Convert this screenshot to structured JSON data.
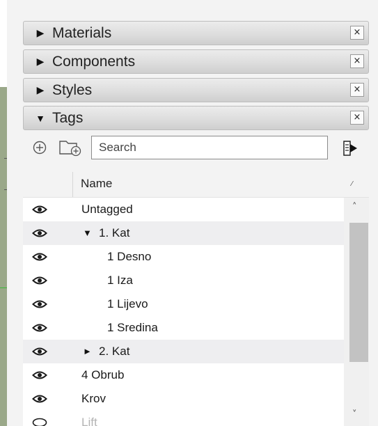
{
  "panels": [
    {
      "title": "Materials",
      "expanded": false,
      "close_label": "×"
    },
    {
      "title": "Components",
      "expanded": false,
      "close_label": "×"
    },
    {
      "title": "Styles",
      "expanded": false,
      "close_label": "×"
    },
    {
      "title": "Tags",
      "expanded": true,
      "close_label": "×"
    }
  ],
  "toolbar": {
    "search_placeholder": "Search",
    "icons": [
      "add-tag-icon",
      "add-folder-icon",
      "details-icon"
    ]
  },
  "table": {
    "column_name": "Name"
  },
  "tags": [
    {
      "label": "Untagged",
      "visible": true,
      "indent": 0,
      "expander": "",
      "alt": false,
      "faded": false
    },
    {
      "label": "1. Kat",
      "visible": true,
      "indent": 1,
      "expander": "▼",
      "alt": true,
      "faded": false
    },
    {
      "label": "1 Desno",
      "visible": true,
      "indent": 2,
      "expander": "",
      "alt": false,
      "faded": false
    },
    {
      "label": "1 Iza",
      "visible": true,
      "indent": 2,
      "expander": "",
      "alt": false,
      "faded": false
    },
    {
      "label": "1 Lijevo",
      "visible": true,
      "indent": 2,
      "expander": "",
      "alt": false,
      "faded": false
    },
    {
      "label": "1 Sredina",
      "visible": true,
      "indent": 2,
      "expander": "",
      "alt": false,
      "faded": false
    },
    {
      "label": "2. Kat",
      "visible": true,
      "indent": 1,
      "expander": "►",
      "alt": true,
      "faded": false
    },
    {
      "label": "4 Obrub",
      "visible": true,
      "indent": 0,
      "expander": "",
      "alt": false,
      "faded": false
    },
    {
      "label": "Krov",
      "visible": true,
      "indent": 0,
      "expander": "",
      "alt": false,
      "faded": false
    },
    {
      "label": "Lift",
      "visible": false,
      "indent": 0,
      "expander": "",
      "alt": false,
      "faded": true
    }
  ],
  "scrollbar": {
    "up_arrow": "˄",
    "down_arrow": "˅"
  },
  "colors": {
    "header_gradient_top": "#ececec",
    "header_gradient_bottom": "#cfcfcf",
    "alt_row": "#eeeef0",
    "scroll_thumb": "#c2c2c2",
    "viewport_green": "#9aa889"
  }
}
